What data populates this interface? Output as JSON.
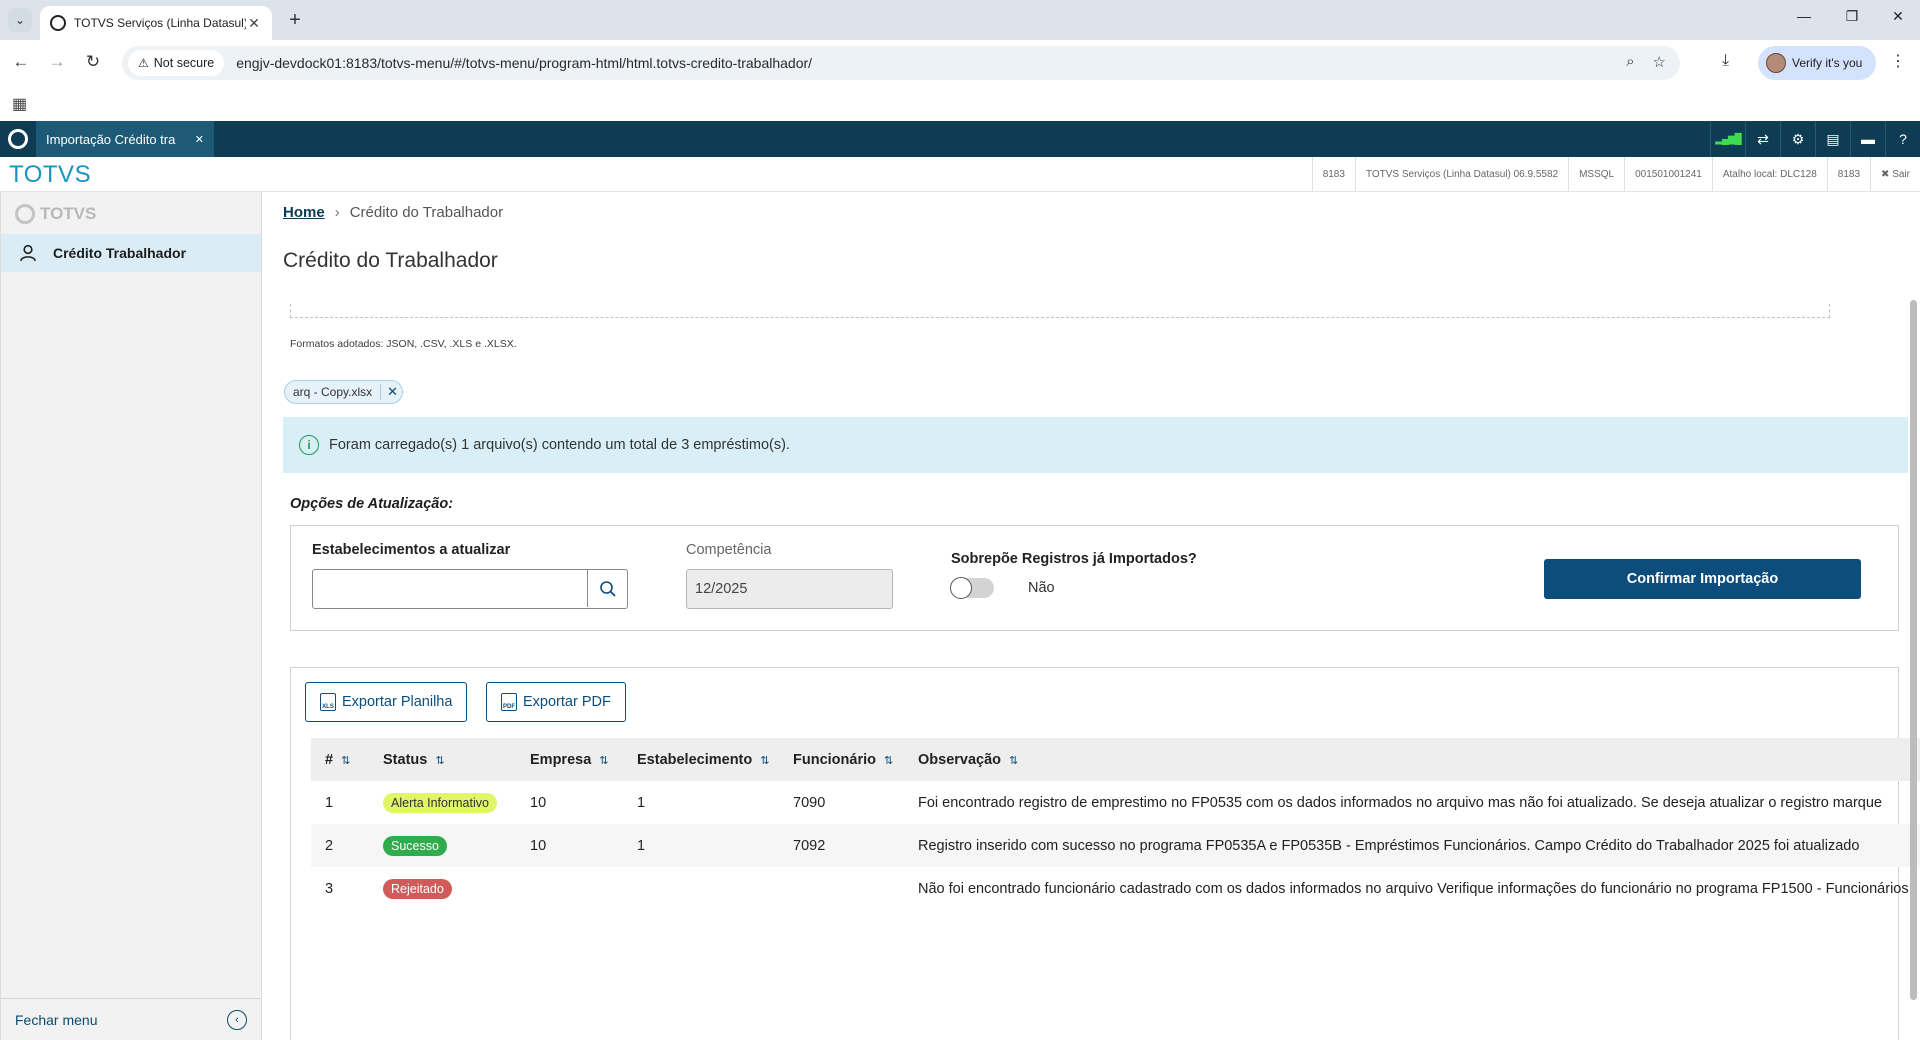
{
  "browser": {
    "tab_title": "TOTVS Serviços (Linha Datasul)",
    "not_secure": "Not secure",
    "url": "engjv-devdock01:8183/totvs-menu/#/totvs-menu/program-html/html.totvs-credito-trabalhador/",
    "verify": "Verify it's you"
  },
  "app": {
    "tab_title": "Importação Crédito tra",
    "brand": "TOTVS",
    "info": [
      "8183",
      "TOTVS Serviços (Linha Datasul) 06.9.5582",
      "MSSQL",
      "001501001241",
      "Atalho local: DLC128",
      "8183",
      "✖ Sair"
    ]
  },
  "sidebar": {
    "logo": "TOTVS",
    "item": "Crédito Trabalhador",
    "close_menu": "Fechar menu"
  },
  "main": {
    "breadcrumb_home": "Home",
    "breadcrumb_current": "Crédito do Trabalhador",
    "title": "Crédito do Trabalhador",
    "formats": "Formatos adotados: JSON, .CSV, .XLS e .XLSX.",
    "file_chip": "arq - Copy.xlsx",
    "alert": "Foram carregado(s) 1 arquivo(s) contendo um total de 3 empréstimo(s).",
    "options_title": "Opções de Atualização:",
    "estab_label": "Estabelecimentos a atualizar",
    "competencia_label": "Competência",
    "competencia_value": "12/2025",
    "sobrepoe_label": "Sobrepõe Registros já Importados?",
    "toggle_value": "Não",
    "confirm_button": "Confirmar Importação",
    "export_sheet": "Exportar Planilha",
    "export_pdf": "Exportar PDF"
  },
  "table": {
    "headers": [
      "#",
      "Status",
      "Empresa",
      "Estabelecimento",
      "Funcionário",
      "Observação"
    ],
    "rows": [
      {
        "n": "1",
        "status": "Alerta Informativo",
        "empresa": "10",
        "estab": "1",
        "func": "7090",
        "obs": "Foi encontrado registro de emprestimo no FP0535 com os dados informados no arquivo mas não foi atualizado. Se deseja atualizar o registro marque"
      },
      {
        "n": "2",
        "status": "Sucesso",
        "empresa": "10",
        "estab": "1",
        "func": "7092",
        "obs": "Registro inserido com sucesso no programa FP0535A e FP0535B - Empréstimos Funcionários. Campo Crédito do Trabalhador 2025 foi atualizado"
      },
      {
        "n": "3",
        "status": "Rejeitado",
        "empresa": "",
        "estab": "",
        "func": "",
        "obs": "Não foi encontrado funcionário cadastrado com os dados informados no arquivo Verifique informações do funcionário no programa FP1500 - Funcionários"
      }
    ]
  }
}
